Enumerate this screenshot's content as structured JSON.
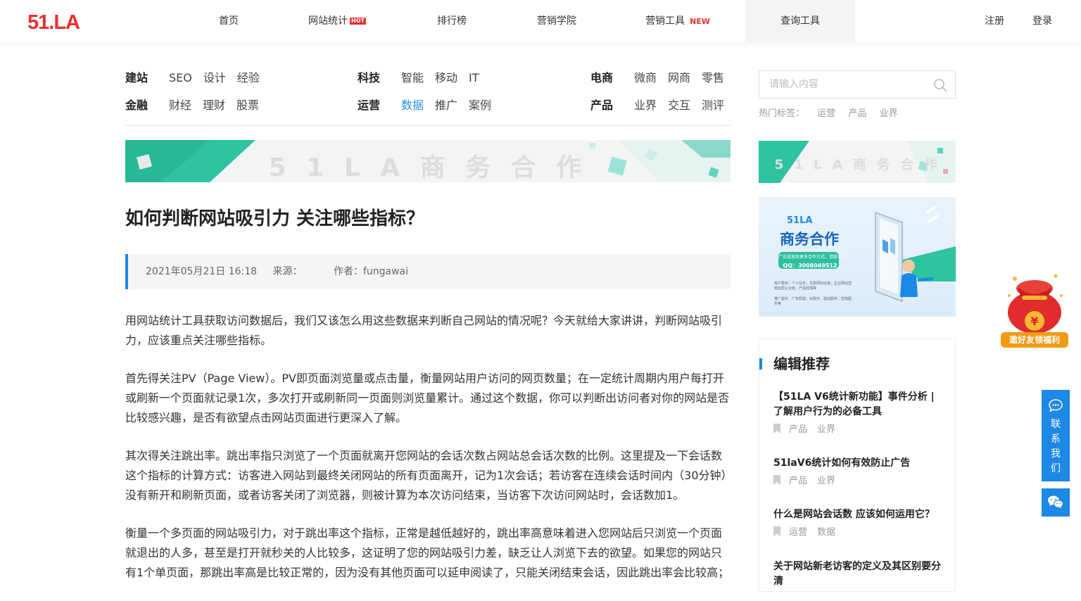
{
  "colors": {
    "accent": "#1e88e5",
    "brand_red": "#e8312f",
    "teal": "#27c2a0"
  },
  "header": {
    "logo": "51.LA",
    "nav": [
      {
        "label": "首页"
      },
      {
        "label": "网站统计",
        "badge": "HOT"
      },
      {
        "label": "排行榜"
      },
      {
        "label": "营销学院"
      },
      {
        "label": "营销工具",
        "badge": "NEW"
      },
      {
        "label": "查询工具",
        "active": true
      }
    ],
    "register": "注册",
    "login": "登录"
  },
  "categories": [
    {
      "title": "建站",
      "tags": [
        "SEO",
        "设计",
        "经验"
      ]
    },
    {
      "title": "金融",
      "tags": [
        "财经",
        "理财",
        "股票"
      ]
    },
    {
      "title": "科技",
      "tags": [
        "智能",
        "移动",
        "IT"
      ]
    },
    {
      "title": "运营",
      "tags": [
        "数据",
        "推广",
        "案例"
      ],
      "active_tag": "数据"
    },
    {
      "title": "电商",
      "tags": [
        "微商",
        "网商",
        "零售"
      ]
    },
    {
      "title": "产品",
      "tags": [
        "业界",
        "交互",
        "测评"
      ]
    }
  ],
  "search": {
    "placeholder": "请输入内容",
    "hot_label": "热门标签：",
    "hot_tags": [
      "运营",
      "产品",
      "业界"
    ]
  },
  "banners": {
    "main": "5 1 L A 商 务 合 作",
    "side": "5 1 L A 商 务 合 作"
  },
  "article": {
    "title": "如何判断网站吸引力 关注哪些指标？",
    "date": "2021年05月21日 16:18",
    "source_label": "来源：",
    "author": "作者：fungawai",
    "paragraphs": [
      "用网站统计工具获取访问数据后，我们又该怎么用这些数据来判断自己网站的情况呢？今天就给大家讲讲，判断网站吸引力，应该重点关注哪些指标。",
      "首先得关注PV（Page View）。PV即页面浏览量或点击量，衡量网站用户访问的网页数量；在一定统计周期内用户每打开或刷新一个页面就记录1次，多次打开或刷新同一页面则浏览量累计。通过这个数据，你可以判断出访问者对你的网站是否比较感兴趣，是否有欲望点击网站页面进行更深入了解。",
      "其次得关注跳出率。跳出率指只浏览了一个页面就离开您网站的会话次数占网站总会话次数的比例。这里提及一下会话数这个指标的计算方式：访客进入网站到最终关闭网站的所有页面离开，记为1次会话；若访客在连续会话时间内（30分钟）没有新开和刷新页面，或者访客关闭了浏览器，则被计算为本次访问结束，当访客下次访问网站时，会话数加1。",
      "衡量一个多页面的网站吸引力，对于跳出率这个指标，正常是越低越好的，跳出率高意味着进入您网站后只浏览一个页面就退出的人多，甚至是打开就秒关的人比较多，这证明了您的网站吸引力差，缺乏让人浏览下去的欲望。如果您的网站只有1个单页面，那跳出率高是比较正常的，因为没有其他页面可以延申阅读了，只能关闭结束会话，因此跳出率会比较高；"
    ]
  },
  "ad": {
    "brand": "51LA",
    "title": "商务合作",
    "contact_line": "广告投放及更多合作方式，请联系",
    "qq": "QQ：3008049512",
    "desc1": "用户群体：个人站长、互联网创业者、企业网站营销运营从业者、产品经理等",
    "desc2": "推广服务：广告联盟、云服务、建站服务、营销服务等"
  },
  "recommend": {
    "heading": "编辑推荐",
    "items": [
      {
        "title": "【51LA V6统计新功能】事件分析 | 了解用户行为的必备工具",
        "tags": [
          "产品",
          "业界"
        ]
      },
      {
        "title": "51laV6统计如何有效防止广告",
        "tags": [
          "产品",
          "业界"
        ]
      },
      {
        "title": "什么是网站会话数 应该如何运用它？",
        "tags": [
          "运营",
          "数据"
        ]
      },
      {
        "title": "关于网站新老访客的定义及其区别要分清",
        "tags": []
      }
    ]
  },
  "floating": {
    "contact": [
      "联",
      "系",
      "我",
      "们"
    ],
    "gift_label": "邀好友领福利",
    "gift_symbol": "¥"
  }
}
